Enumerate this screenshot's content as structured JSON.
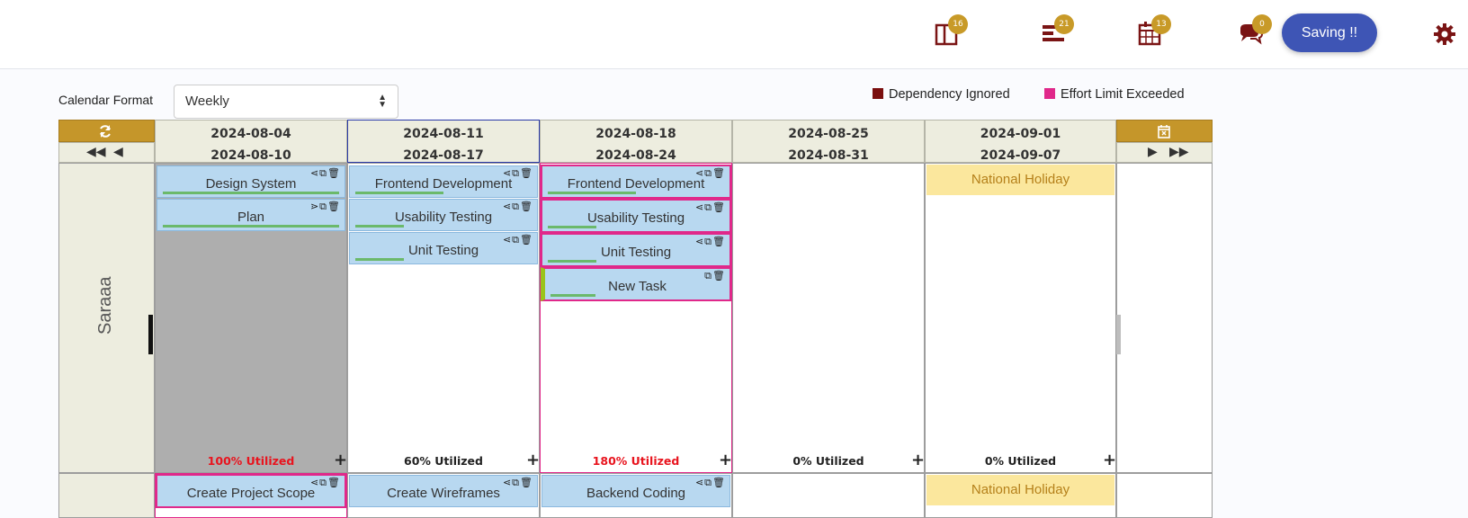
{
  "topbar": {
    "icons": [
      {
        "name": "board-icon",
        "badge": "16"
      },
      {
        "name": "gantt-list-icon",
        "badge": "21"
      },
      {
        "name": "calendar-grid-icon",
        "badge": "13"
      },
      {
        "name": "chat-icon",
        "badge": "0"
      }
    ],
    "save_label": "Saving !!",
    "settings_icon": "gear-icon"
  },
  "calendar": {
    "format_label": "Calendar Format",
    "format_value": "Weekly"
  },
  "legend": [
    {
      "label": "Dependency Ignored",
      "color": "#7a0e0e"
    },
    {
      "label": "Effort Limit Exceeded",
      "color": "#e0288a"
    }
  ],
  "weeks": [
    {
      "start": "2024-08-04",
      "end": "2024-08-10"
    },
    {
      "start": "2024-08-11",
      "end": "2024-08-17"
    },
    {
      "start": "2024-08-18",
      "end": "2024-08-24"
    },
    {
      "start": "2024-08-25",
      "end": "2024-08-31"
    },
    {
      "start": "2024-09-01",
      "end": "2024-09-07"
    }
  ],
  "resources": [
    {
      "name": "Saraaa",
      "columns": [
        {
          "tasks": [
            {
              "name": "Design System",
              "progress": 1.0
            },
            {
              "name": "Plan",
              "progress": 1.0
            }
          ],
          "utilization": "100% Utilized",
          "util_color": "#e8141e"
        },
        {
          "tasks": [
            {
              "name": "Frontend Development",
              "progress": 0.5
            },
            {
              "name": "Usability Testing",
              "progress": 0.27
            },
            {
              "name": "Unit Testing",
              "progress": 0.27
            }
          ],
          "utilization": "60% Utilized",
          "util_color": "#222222"
        },
        {
          "tasks": [
            {
              "name": "Frontend Development",
              "progress": 0.5
            },
            {
              "name": "Usability Testing",
              "progress": 0.27
            },
            {
              "name": "Unit Testing",
              "progress": 0.27
            },
            {
              "name": "New Task",
              "progress": 0.27
            }
          ],
          "utilization": "180% Utilized",
          "util_color": "#e8141e"
        },
        {
          "tasks": [],
          "utilization": "0% Utilized",
          "util_color": "#222222"
        },
        {
          "holiday": "National Holiday",
          "utilization": "0% Utilized",
          "util_color": "#222222"
        }
      ]
    },
    {
      "name": "",
      "columns": [
        {
          "tasks": [
            {
              "name": "Create Project Scope"
            }
          ]
        },
        {
          "tasks": [
            {
              "name": "Create Wireframes"
            }
          ]
        },
        {
          "tasks": [
            {
              "name": "Backend Coding"
            }
          ]
        },
        {
          "tasks": []
        },
        {
          "holiday": "National Holiday"
        }
      ]
    }
  ]
}
